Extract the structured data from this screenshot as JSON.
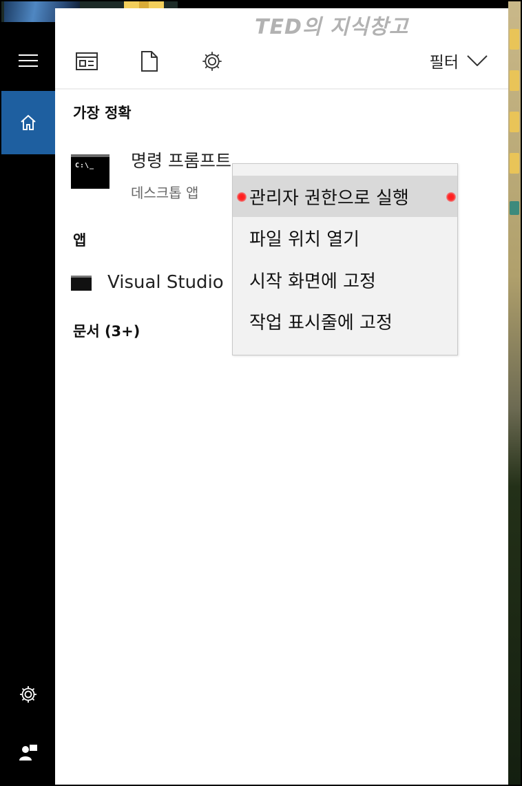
{
  "watermark": "TED의 지식창고",
  "rail": {
    "items": [
      {
        "name": "menu",
        "icon": "hamburger-icon"
      },
      {
        "name": "home",
        "icon": "home-icon",
        "active": true
      },
      {
        "name": "settings",
        "icon": "gear-icon"
      },
      {
        "name": "user",
        "icon": "user-icon"
      }
    ],
    "accent_color": "#1e5fa0"
  },
  "toolbar": {
    "icons": [
      "apps-icon",
      "document-icon",
      "settings-icon"
    ],
    "filter_label": "필터"
  },
  "best_match": {
    "heading": "가장 정확",
    "title": "명령 프롬프트",
    "subtitle": "데스크톱 앱",
    "icon": "command-prompt-icon",
    "icon_text": "C:\\_"
  },
  "apps": {
    "heading": "앱",
    "items": [
      {
        "label": "Visual Studio",
        "icon": "terminal-icon"
      }
    ]
  },
  "documents": {
    "heading": "문서 (3+)"
  },
  "context_menu": {
    "items": [
      {
        "label": "관리자 권한으로 실행",
        "highlighted": true
      },
      {
        "label": "파일 위치 열기"
      },
      {
        "label": "시작 화면에 고정"
      },
      {
        "label": "작업 표시줄에 고정"
      }
    ]
  }
}
